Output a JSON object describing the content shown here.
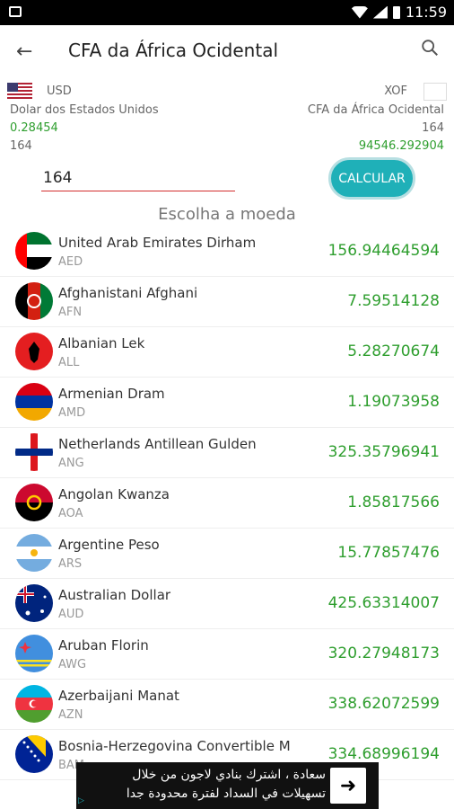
{
  "status_bar": {
    "time": "11:59"
  },
  "toolbar": {
    "title": "CFA da África Ocidental"
  },
  "conversion": {
    "from_code": "USD",
    "from_name": "Dolar dos Estados Unidos",
    "from_rate": "0.28454",
    "from_amount": "164",
    "to_code": "XOF",
    "to_name": "CFA da África Ocidental",
    "to_amount": "164",
    "to_result": "94546.292904"
  },
  "input": {
    "value": "164"
  },
  "calculate_label": "CALCULAR",
  "choose_label": "Escolha a moeda",
  "currencies": [
    {
      "name": "United Arab Emirates Dirham",
      "code": "AED",
      "value": "156.94464594"
    },
    {
      "name": "Afghanistani Afghani",
      "code": "AFN",
      "value": "7.59514128"
    },
    {
      "name": "Albanian Lek",
      "code": "ALL",
      "value": "5.28270674"
    },
    {
      "name": "Armenian Dram",
      "code": "AMD",
      "value": "1.19073958"
    },
    {
      "name": "Netherlands Antillean Gulden",
      "code": "ANG",
      "value": "325.35796941"
    },
    {
      "name": "Angolan Kwanza",
      "code": "AOA",
      "value": "1.85817566"
    },
    {
      "name": "Argentine Peso",
      "code": "ARS",
      "value": "15.77857476"
    },
    {
      "name": "Australian Dollar",
      "code": "AUD",
      "value": "425.63314007"
    },
    {
      "name": "Aruban Florin",
      "code": "AWG",
      "value": "320.27948173"
    },
    {
      "name": "Azerbaijani Manat",
      "code": "AZN",
      "value": "338.62072599"
    },
    {
      "name": "Bosnia-Herzegovina Convertible M",
      "code": "BAM",
      "value": "334.68996194"
    }
  ],
  "ad": {
    "line1": "سعادة ، اشترك بنادي لاجون من خلال",
    "line2": "تسهيلات في السداد لفترة محدودة جدا"
  }
}
